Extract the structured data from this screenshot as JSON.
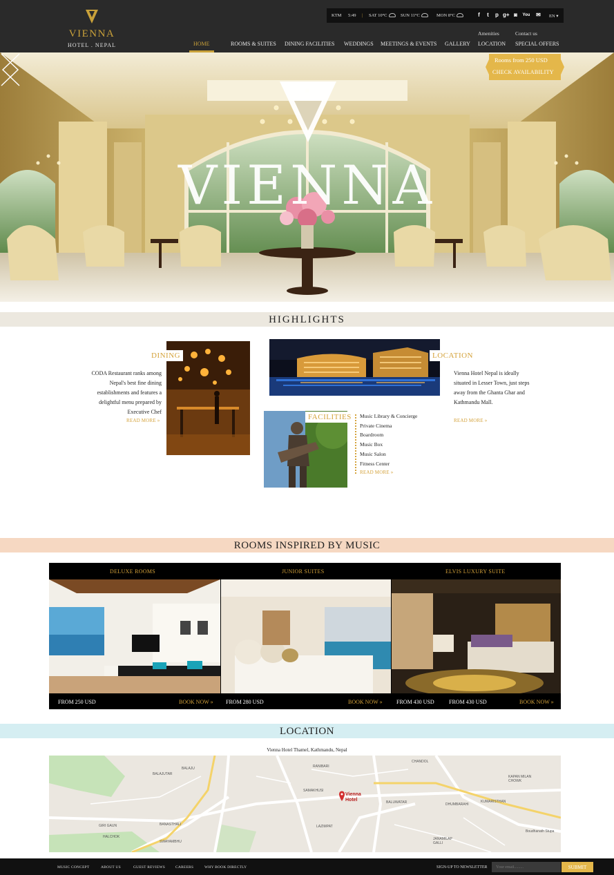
{
  "header": {
    "logo": {
      "name": "VIENNA",
      "tagline": "HOTEL . NEPAL"
    },
    "topbar": {
      "city": "KTM",
      "time": "5:49",
      "weather": [
        {
          "day": "SAT",
          "temp": "10°C"
        },
        {
          "day": "SUN",
          "temp": "11°C"
        },
        {
          "day": "MON",
          "temp": "8°C"
        }
      ],
      "social": [
        "facebook-icon",
        "twitter-icon",
        "pinterest-icon",
        "google-plus-icon",
        "instagram-icon",
        "youtube-icon",
        "email-icon"
      ],
      "language": "EN ▾"
    },
    "aux_links": [
      "Amenities",
      "Contact us"
    ],
    "nav": [
      "HOME",
      "ROOMS & SUITES",
      "DINING FACILITIES",
      "WEDDINGS",
      "MEETINGS & EVENTS",
      "GALLERY",
      "LOCATION",
      "SPECIAL OFFERS"
    ],
    "active_nav": "HOME",
    "accent": "#c9a13a",
    "bg": "#2a2a2a"
  },
  "hero": {
    "brand": "VIENNA",
    "rooms_from": "Rooms from 250 USD",
    "check_availability": "CHECK AVAILABILITY"
  },
  "highlights": {
    "title": "HIGHLIGHTS",
    "dining": {
      "title": "DINING",
      "text": "CODA Restaurant ranks among Nepal's best fine dining establishments and features a delightful menu prepared by Executive Chef",
      "read_more": "READ MORE »"
    },
    "location": {
      "title": "LOCATION",
      "text": "Vienna Hotel Nepal is ideally situated in Lesser Town, just steps away from the Ghanta Ghar and Kathmandu Mall.",
      "read_more": "READ MORE »"
    },
    "facilities": {
      "title": "FACILITIES",
      "items": [
        "Music Library & Concierge",
        "Private Cinema",
        "Boardroom",
        "Music Box",
        "Music Salon",
        "Fitness Center"
      ],
      "read_more": "READ MORE »"
    }
  },
  "rooms": {
    "title": "ROOMS INSPIRED BY MUSIC",
    "items": [
      {
        "name": "DELUXE ROOMS",
        "price": "FROM  250 USD",
        "book": "BOOK NOW »"
      },
      {
        "name": "JUNIOR SUITES",
        "price": "FROM  280 USD",
        "book": "BOOK NOW »"
      },
      {
        "name": "ELVIS LUXURY SUITE",
        "price": "FROM  430 USD",
        "price2": "FROM  430 USD",
        "book": "BOOK NOW »"
      }
    ]
  },
  "location": {
    "title": "LOCATION",
    "address": "Vienna Hotel Thamel, Kathmandu, Nepal",
    "map_marker": "Vienna Hotel",
    "map_labels": [
      "BALAJU",
      "BALAJUTAR",
      "RANIBARI",
      "CHANDOL",
      "SAMAKHUSI",
      "BALUWATAR",
      "KAPAN MILAN CHOWK",
      "KUMARISTHAN",
      "DHUMBARAHI",
      "GIRI GAUN",
      "BANASTHALI",
      "LAZIMPAT",
      "HALCHOK",
      "SWAYAMBHU",
      "JANAMILAP GALLI",
      "Boudhanath Stupa"
    ]
  },
  "footer": {
    "links": [
      "MUSIC CONCEPT",
      "ABOUT US",
      "GUEST REVIEWS",
      "CAREERS",
      "WHY BOOK DIRECTLY"
    ],
    "newsletter_label": "SIGN-UP TO NEWSLETTER",
    "email_placeholder": "Your email.........",
    "submit": "SUBMIT"
  }
}
